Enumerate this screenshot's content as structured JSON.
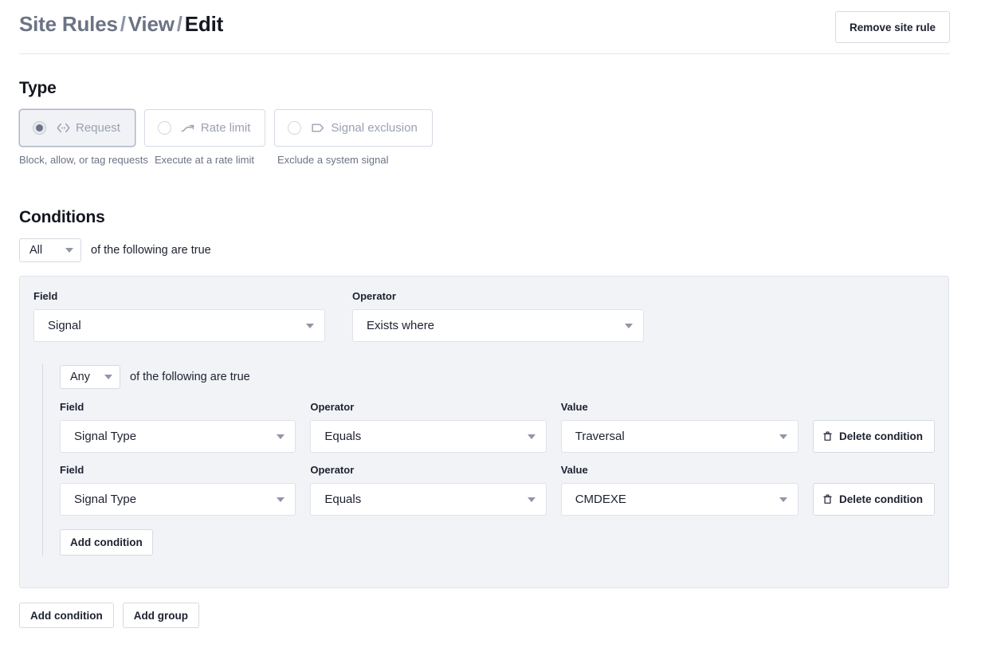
{
  "header": {
    "breadcrumb": {
      "root": "Site Rules",
      "separator": "/",
      "middle": "View",
      "current": "Edit"
    },
    "remove_button": "Remove site rule"
  },
  "type_section": {
    "title": "Type",
    "options": [
      {
        "label": "Request",
        "icon": "code-brackets-icon",
        "helper": "Block, allow, or tag requests",
        "selected": true
      },
      {
        "label": "Rate limit",
        "icon": "trend-line-icon",
        "helper": "Execute at a rate limit",
        "selected": false
      },
      {
        "label": "Signal exclusion",
        "icon": "tag-icon",
        "helper": "Exclude a system signal",
        "selected": false
      }
    ]
  },
  "conditions_section": {
    "title": "Conditions",
    "top_combinator": {
      "value": "All",
      "suffix": "of the following are true"
    },
    "labels": {
      "field": "Field",
      "operator": "Operator",
      "value": "Value"
    },
    "outer_condition": {
      "field": "Signal",
      "operator": "Exists where"
    },
    "nested_group": {
      "combinator": {
        "value": "Any",
        "suffix": "of the following are true"
      },
      "conditions": [
        {
          "field": "Signal Type",
          "operator": "Equals",
          "value": "Traversal",
          "delete_label": "Delete condition"
        },
        {
          "field": "Signal Type",
          "operator": "Equals",
          "value": "CMDEXE",
          "delete_label": "Delete condition"
        }
      ],
      "add_condition_label": "Add condition"
    },
    "footer": {
      "add_condition_label": "Add condition",
      "add_group_label": "Add group"
    }
  },
  "colors": {
    "panel_bg": "#f1f3f7",
    "panel_border": "#dfe2e9",
    "text_primary": "#1d2130",
    "text_muted": "#6b7385",
    "control_border": "#d6dae2",
    "disabled_label": "#9aa1b1"
  }
}
